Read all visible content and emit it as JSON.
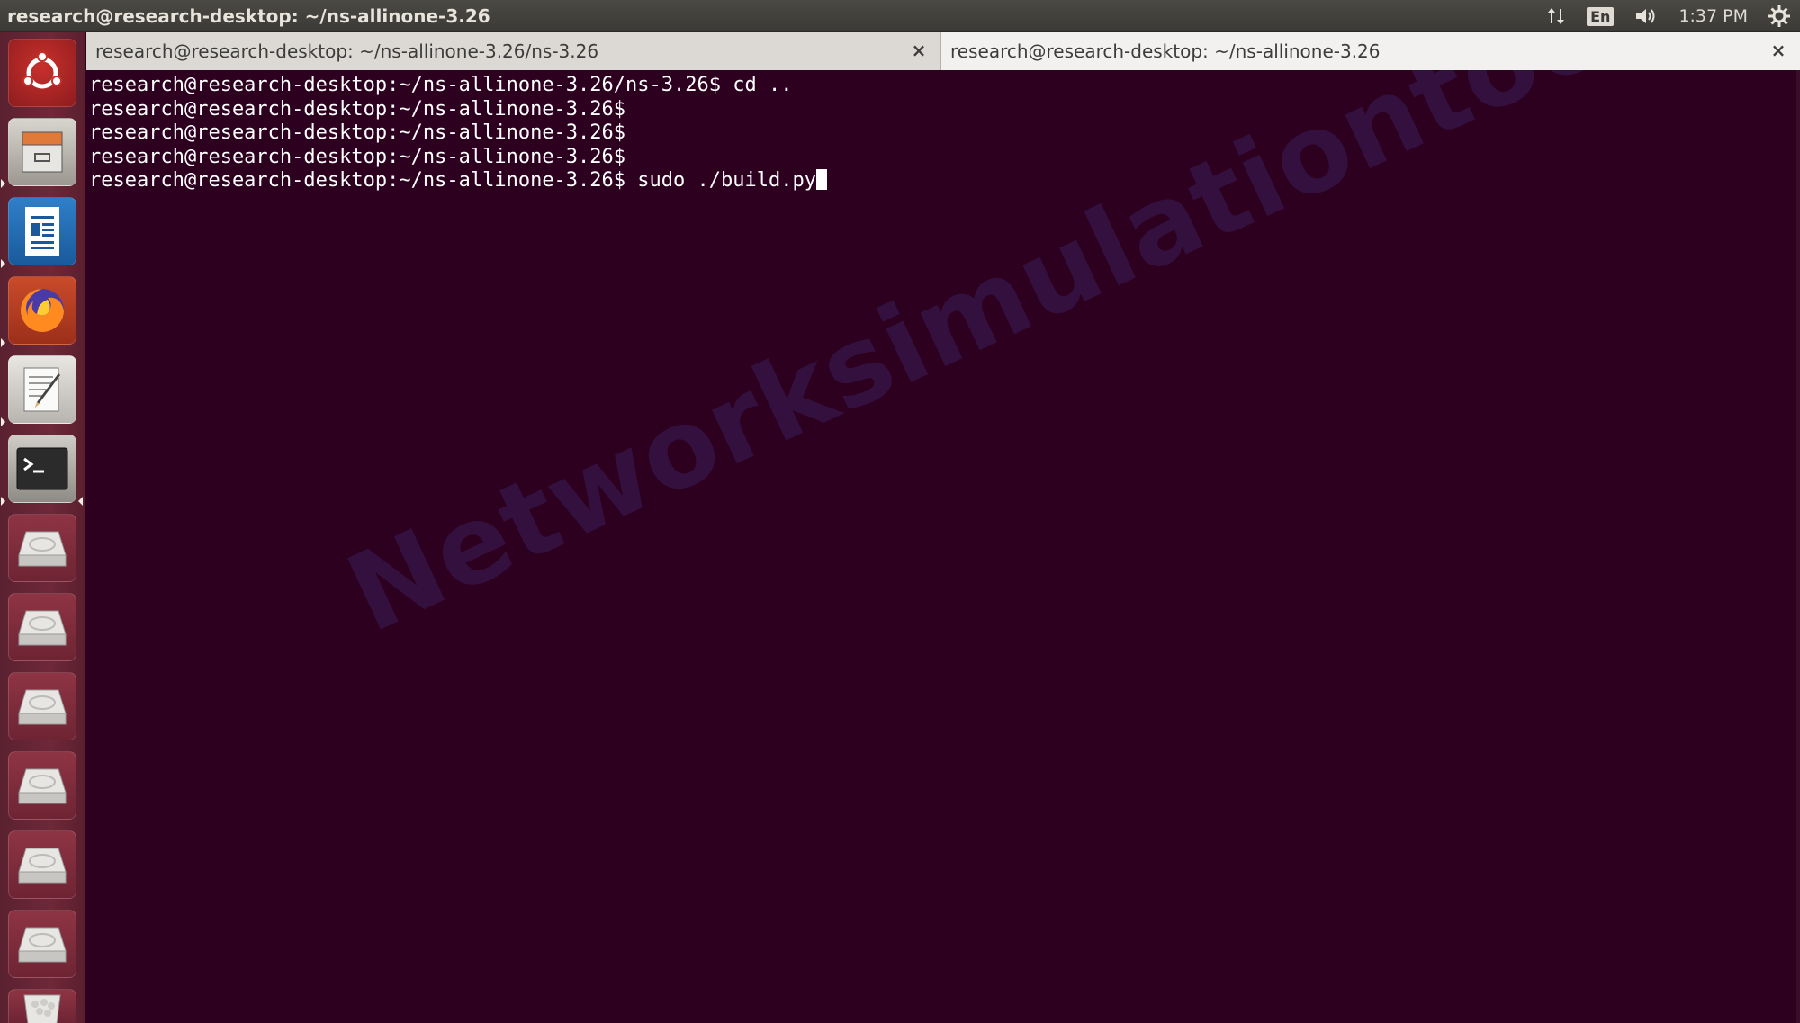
{
  "top_panel": {
    "window_title": "research@research-desktop: ~/ns-allinone-3.26",
    "indicators": {
      "network_icon": "updown-arrows-icon",
      "keyboard_lang": "En",
      "sound_icon": "speaker-icon",
      "clock": "1:37 PM",
      "system_icon": "gear-icon"
    }
  },
  "launcher": {
    "items": [
      {
        "name": "ubuntu-dash",
        "icon": "ubuntu-logo-icon"
      },
      {
        "name": "files",
        "icon": "file-cabinet-icon"
      },
      {
        "name": "libreoffice-writer",
        "icon": "document-icon"
      },
      {
        "name": "firefox",
        "icon": "firefox-icon"
      },
      {
        "name": "text-editor",
        "icon": "pencil-notepad-icon"
      },
      {
        "name": "terminal",
        "icon": "terminal-icon"
      },
      {
        "name": "drive-1",
        "icon": "hard-drive-icon"
      },
      {
        "name": "drive-2",
        "icon": "hard-drive-icon"
      },
      {
        "name": "drive-3",
        "icon": "hard-drive-icon"
      },
      {
        "name": "drive-4",
        "icon": "hard-drive-icon"
      },
      {
        "name": "drive-5",
        "icon": "hard-drive-icon"
      },
      {
        "name": "drive-6",
        "icon": "hard-drive-icon"
      },
      {
        "name": "trash",
        "icon": "trash-icon"
      }
    ]
  },
  "terminal": {
    "tabs": [
      {
        "label": "research@research-desktop: ~/ns-allinone-3.26/ns-3.26",
        "close": "×"
      },
      {
        "label": "research@research-desktop: ~/ns-allinone-3.26",
        "close": "×"
      }
    ],
    "lines": [
      "research@research-desktop:~/ns-allinone-3.26/ns-3.26$ cd ..",
      "research@research-desktop:~/ns-allinone-3.26$",
      "research@research-desktop:~/ns-allinone-3.26$",
      "research@research-desktop:~/ns-allinone-3.26$",
      "research@research-desktop:~/ns-allinone-3.26$ sudo ./build.py"
    ],
    "watermark": "Networksimulationtools.com"
  },
  "colors": {
    "terminal_bg": "#2c001e",
    "launcher_bg": "#6e2838",
    "panel_bg": "#3b3a36",
    "text": "#ffffff"
  }
}
